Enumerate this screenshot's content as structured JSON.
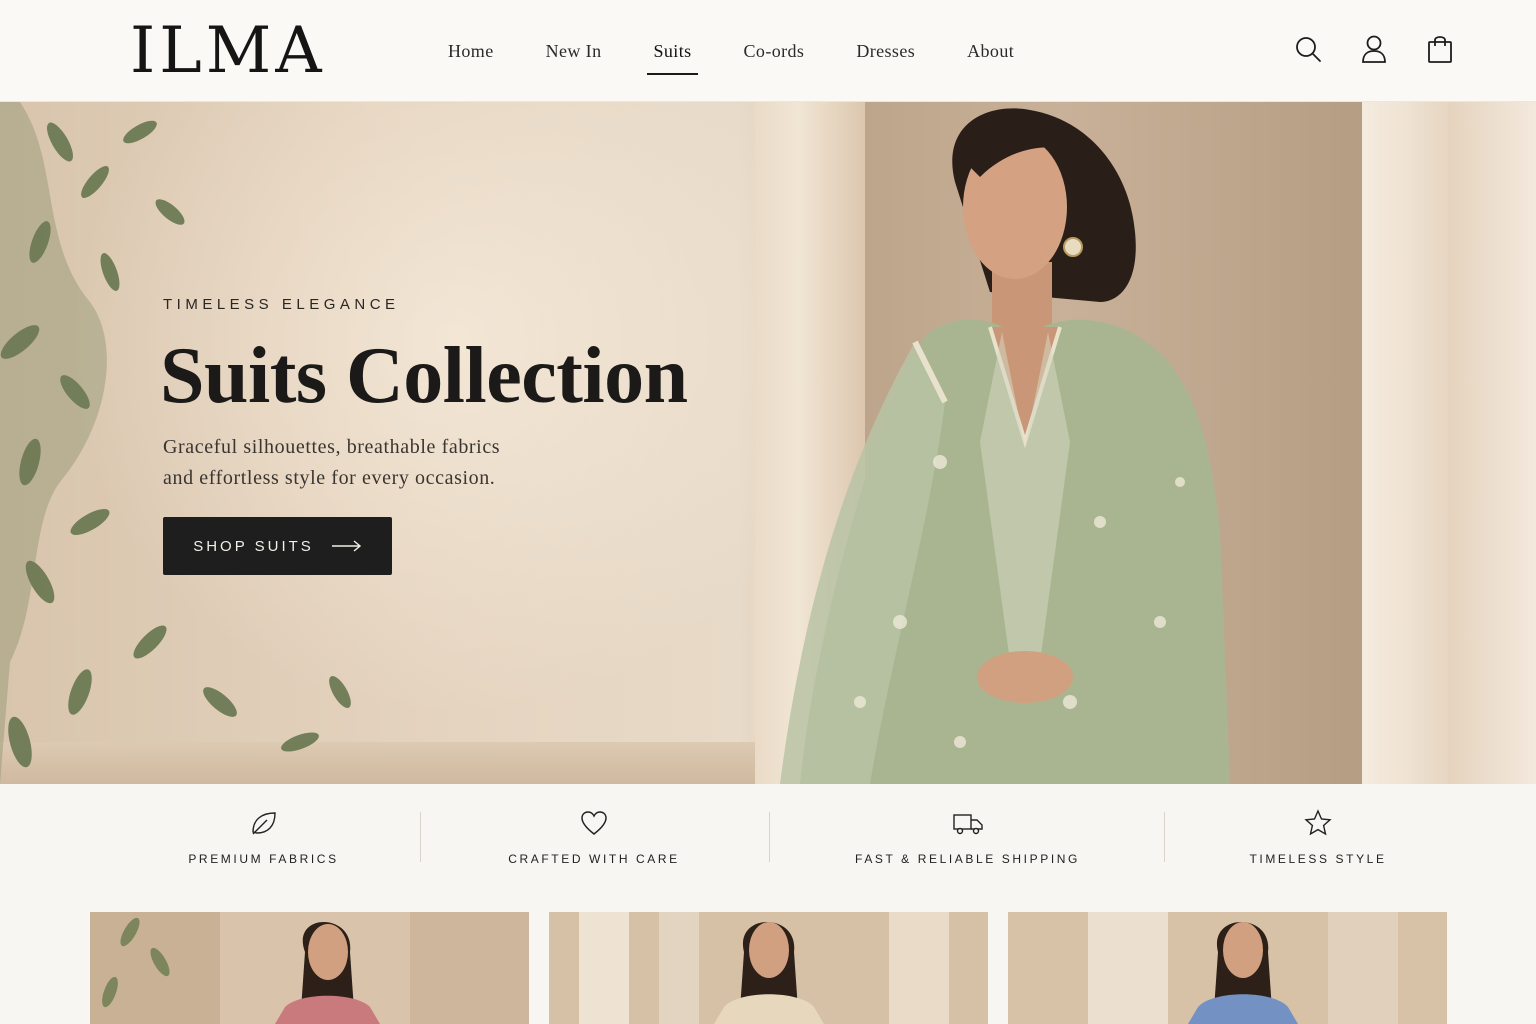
{
  "brand": {
    "logo": "ILMA"
  },
  "nav": {
    "items": [
      {
        "label": "Home"
      },
      {
        "label": "New In"
      },
      {
        "label": "Suits",
        "active": true
      },
      {
        "label": "Co-ords"
      },
      {
        "label": "Dresses"
      },
      {
        "label": "About"
      }
    ]
  },
  "header_icons": [
    "search-icon",
    "account-icon",
    "shopping-bag-icon"
  ],
  "hero": {
    "eyebrow": "TIMELESS ELEGANCE",
    "title": "Suits Collection",
    "subtitle_line1": "Graceful silhouettes, breathable fabrics",
    "subtitle_line2": "and effortless style for every occasion.",
    "cta_label": "SHOP SUITS"
  },
  "features": [
    {
      "icon": "leaf-icon",
      "label": "PREMIUM FABRICS"
    },
    {
      "icon": "heart-icon",
      "label": "CRAFTED WITH CARE"
    },
    {
      "icon": "truck-icon",
      "label": "FAST & RELIABLE SHIPPING"
    },
    {
      "icon": "star-icon",
      "label": "TIMELESS STYLE"
    }
  ],
  "products": [
    {
      "suit_color": "#c97a7c"
    },
    {
      "suit_color": "#e6d7bd"
    },
    {
      "suit_color": "#7391c2"
    }
  ],
  "colors": {
    "accent": "#1e1e1e",
    "background": "#f8f6f2",
    "hero_suit": "#a7b48f"
  }
}
